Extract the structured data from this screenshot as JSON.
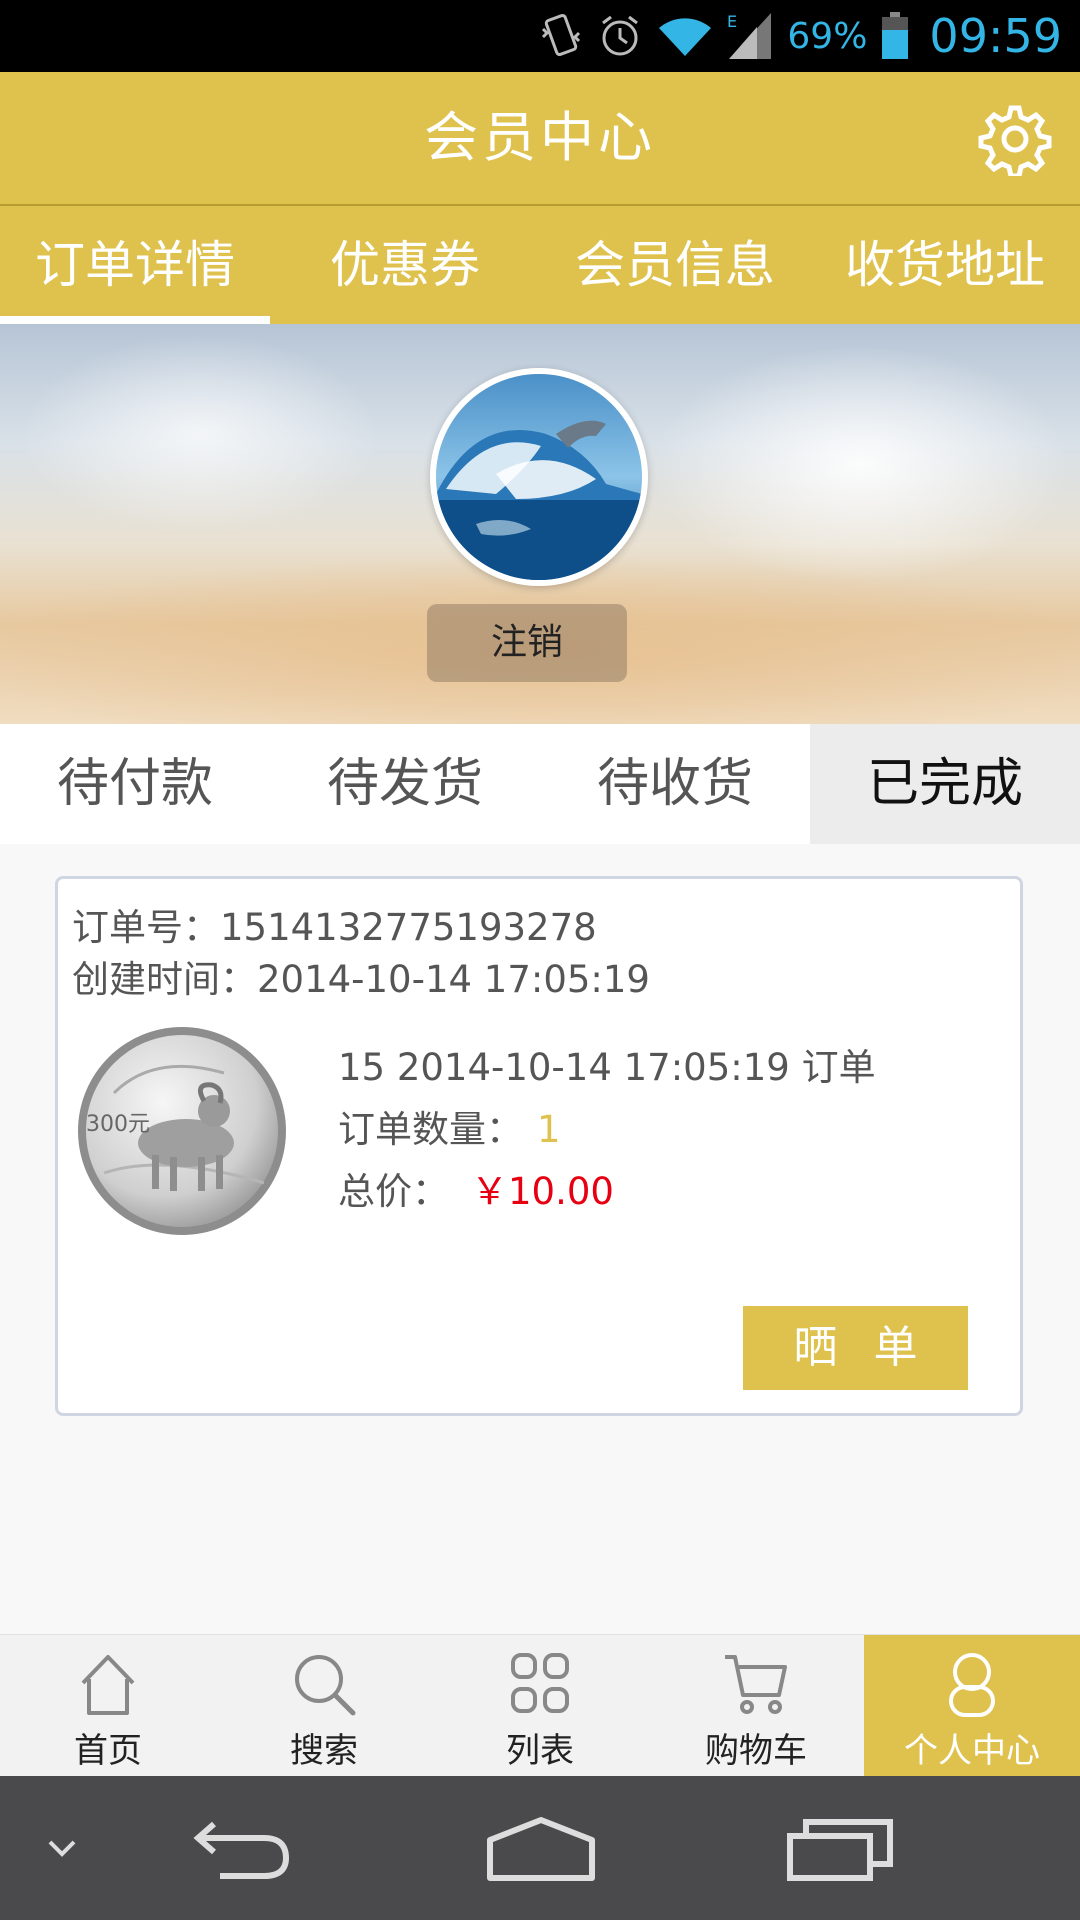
{
  "status_bar": {
    "battery_percent": "69%",
    "time": "09:59",
    "network_type": "E",
    "icons": [
      "vibrate-icon",
      "alarm-icon",
      "wifi-icon",
      "signal-icon",
      "battery-icon"
    ]
  },
  "header": {
    "title": "会员中心",
    "settings_icon": "gear-icon"
  },
  "top_tabs": [
    {
      "label": "订单详情",
      "active": true
    },
    {
      "label": "优惠券",
      "active": false
    },
    {
      "label": "会员信息",
      "active": false
    },
    {
      "label": "收货地址",
      "active": false
    }
  ],
  "profile": {
    "logout_label": "注销"
  },
  "order_tabs": [
    {
      "label": "待付款",
      "active": false
    },
    {
      "label": "待发货",
      "active": false
    },
    {
      "label": "待收货",
      "active": false
    },
    {
      "label": "已完成",
      "active": true
    }
  ],
  "order": {
    "order_no_label": "订单号：",
    "order_no": "1514132775193278",
    "created_label": "创建时间：",
    "created_at": "2014-10-14 17:05:19",
    "title": "15 2014-10-14 17:05:19 订单",
    "qty_label": "订单数量：",
    "qty": "1",
    "total_label": "总价：",
    "total": "￥10.00",
    "coin_text": "300元",
    "share_label": "晒单"
  },
  "bottom_nav": [
    {
      "label": "首页",
      "icon": "home-icon",
      "active": false
    },
    {
      "label": "搜索",
      "icon": "search-icon",
      "active": false
    },
    {
      "label": "列表",
      "icon": "grid-icon",
      "active": false
    },
    {
      "label": "购物车",
      "icon": "cart-icon",
      "active": false
    },
    {
      "label": "个人中心",
      "icon": "user-icon",
      "active": true
    }
  ],
  "colors": {
    "accent": "#dfc24e",
    "price": "#e60012",
    "status_blue": "#33b5e5"
  }
}
